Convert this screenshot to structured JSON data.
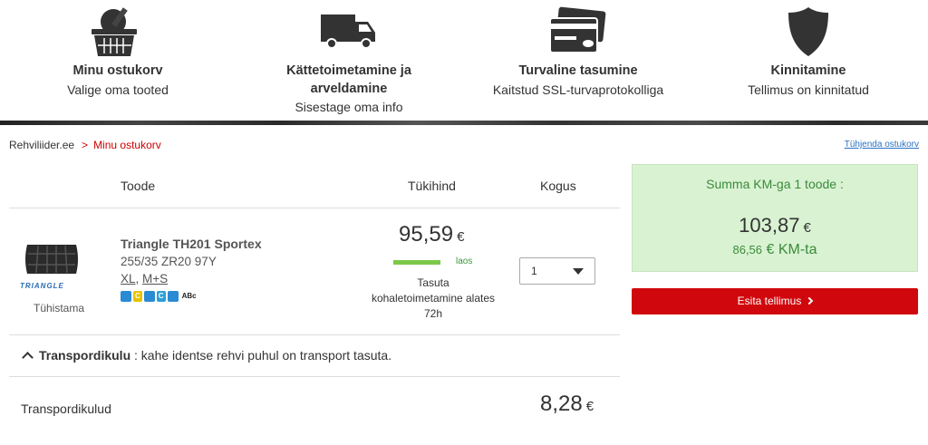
{
  "steps": [
    {
      "title": "Minu ostukorv",
      "sub1": "Valige oma tooted",
      "sub2": ""
    },
    {
      "title": "Kättetoimetamine ja",
      "title2": "arveldamine",
      "sub1": "Sisestage oma info"
    },
    {
      "title": "Turvaline tasumine",
      "sub1": "Kaitstud SSL-turvaprotokolliga"
    },
    {
      "title": "Kinnitamine",
      "sub1": "Tellimus on kinnitatud"
    }
  ],
  "breadcrumb": {
    "home": "Rehviliider.ee",
    "sep": ">",
    "current": "Minu ostukorv"
  },
  "empty_cart_link": "Tühjenda ostukorv",
  "table": {
    "headers": {
      "product": "Toode",
      "unit_price": "Tükihind",
      "quantity": "Kogus"
    }
  },
  "item": {
    "brand_logo": "TRIANGLE",
    "image_caption": "Tühistama",
    "name": "Triangle TH201 Sportex",
    "size": "255/35 ZR20 97Y",
    "xl": "XL",
    "ms": "M+S",
    "label_badges": [
      "C",
      "C",
      "ABc"
    ],
    "price": "95,59",
    "currency": "€",
    "stock": "laos",
    "shipping_line1": "Tasuta",
    "shipping_line2": "kohaletoimetamine alates",
    "shipping_line3": "72h",
    "quantity": "1",
    "stock_color": "#7cc84a"
  },
  "transport_note": {
    "label": "Transpordikulu",
    "text": " : kahe identse rehvi puhul on transport tasuta."
  },
  "transport_cost": {
    "label": "Transpordikulud",
    "value": "8,28",
    "currency": "€"
  },
  "summary": {
    "heading": "Summa KM-ga 1 toode :",
    "total": "103,87",
    "currency": "€",
    "net_value": "86,56",
    "net_suffix": "€ KM-ta"
  },
  "order_button": {
    "label": "Esita tellimus",
    "color": "#d0080d"
  }
}
